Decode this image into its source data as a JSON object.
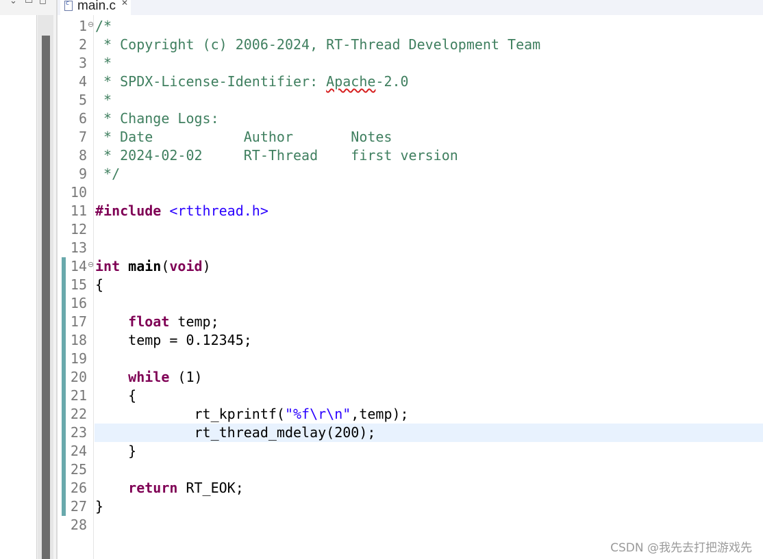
{
  "left_view": {
    "toolbar_icons": [
      "chevron-down-icon",
      "minimize-icon",
      "maximize-icon"
    ]
  },
  "editor_tab": {
    "file_name": "main.c",
    "close_glyph": "✕"
  },
  "code_lines": [
    {
      "n": "1",
      "fold": "⊖",
      "tokens": [
        {
          "t": "/*",
          "c": "cm"
        }
      ]
    },
    {
      "n": "2",
      "tokens": [
        {
          "t": " * Copyright (c) 2006-2024, RT-Thread Development Team",
          "c": "cm"
        }
      ]
    },
    {
      "n": "3",
      "tokens": [
        {
          "t": " *",
          "c": "cm"
        }
      ]
    },
    {
      "n": "4",
      "tokens": [
        {
          "t": " * SPDX-License-Identifier: ",
          "c": "cm"
        },
        {
          "t": "Apache",
          "c": "cm sq"
        },
        {
          "t": "-2.0",
          "c": "cm"
        }
      ]
    },
    {
      "n": "5",
      "tokens": [
        {
          "t": " *",
          "c": "cm"
        }
      ]
    },
    {
      "n": "6",
      "tokens": [
        {
          "t": " * Change Logs:",
          "c": "cm"
        }
      ]
    },
    {
      "n": "7",
      "tokens": [
        {
          "t": " * Date           Author       Notes",
          "c": "cm"
        }
      ]
    },
    {
      "n": "8",
      "tokens": [
        {
          "t": " * 2024-02-02     RT-Thread    first version",
          "c": "cm"
        }
      ]
    },
    {
      "n": "9",
      "tokens": [
        {
          "t": " */",
          "c": "cm"
        }
      ]
    },
    {
      "n": "10",
      "tokens": []
    },
    {
      "n": "11",
      "tokens": [
        {
          "t": "#include",
          "c": "kw"
        },
        {
          "t": " "
        },
        {
          "t": "<rtthread.h>",
          "c": "str"
        }
      ]
    },
    {
      "n": "12",
      "tokens": []
    },
    {
      "n": "13",
      "tokens": []
    },
    {
      "n": "14",
      "fold": "⊖",
      "tokens": [
        {
          "t": "int",
          "c": "kw"
        },
        {
          "t": " "
        },
        {
          "t": "main",
          "c": "fn"
        },
        {
          "t": "("
        },
        {
          "t": "void",
          "c": "kw"
        },
        {
          "t": ")"
        }
      ]
    },
    {
      "n": "15",
      "tokens": [
        {
          "t": "{"
        }
      ]
    },
    {
      "n": "16",
      "tokens": []
    },
    {
      "n": "17",
      "tokens": [
        {
          "t": "    "
        },
        {
          "t": "float",
          "c": "kw"
        },
        {
          "t": " temp;"
        }
      ]
    },
    {
      "n": "18",
      "tokens": [
        {
          "t": "    temp = 0.12345;"
        }
      ]
    },
    {
      "n": "19",
      "tokens": []
    },
    {
      "n": "20",
      "tokens": [
        {
          "t": "    "
        },
        {
          "t": "while",
          "c": "kw"
        },
        {
          "t": " (1)"
        }
      ]
    },
    {
      "n": "21",
      "tokens": [
        {
          "t": "    {"
        }
      ]
    },
    {
      "n": "22",
      "tokens": [
        {
          "t": "            rt_kprintf("
        },
        {
          "t": "\"%f\\r\\n\"",
          "c": "str"
        },
        {
          "t": ",temp);"
        }
      ]
    },
    {
      "n": "23",
      "current": true,
      "tokens": [
        {
          "t": "            rt_thread_mdelay(200);"
        }
      ]
    },
    {
      "n": "24",
      "tokens": [
        {
          "t": "    }"
        }
      ]
    },
    {
      "n": "25",
      "tokens": []
    },
    {
      "n": "26",
      "tokens": [
        {
          "t": "    "
        },
        {
          "t": "return",
          "c": "kw"
        },
        {
          "t": " RT_EOK;"
        }
      ]
    },
    {
      "n": "27",
      "tokens": [
        {
          "t": "}"
        }
      ]
    },
    {
      "n": "28",
      "tokens": []
    }
  ],
  "changed_lines": {
    "first": "14",
    "last": "27"
  },
  "colors": {
    "comment": "#3f7f5f",
    "keyword": "#7f0055",
    "string": "#2a00ff",
    "current_line": "#e8f2fe",
    "change_bar": "#69a9ac"
  },
  "watermark": "CSDN @我先去打把游戏先"
}
